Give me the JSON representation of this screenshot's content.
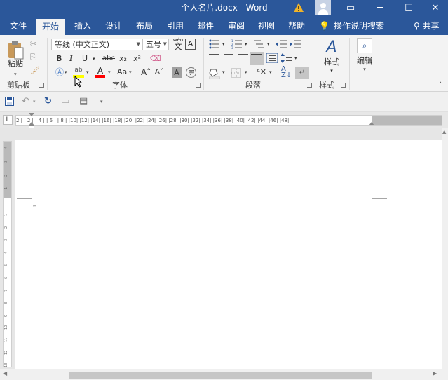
{
  "titlebar": {
    "title": "个人名片.docx  -  Word",
    "minimize": "─",
    "restore": "☐",
    "close": "✕",
    "ribbon_display": "▭"
  },
  "tabs": [
    "文件",
    "开始",
    "插入",
    "设计",
    "布局",
    "引用",
    "邮件",
    "审阅",
    "视图",
    "帮助"
  ],
  "active_tab": "开始",
  "tell_me": "操作说明搜索",
  "share": "共享",
  "ribbon": {
    "clipboard": {
      "paste_label": "粘贴",
      "group_label": "剪贴板"
    },
    "font": {
      "font_name": "等线 (中文正文)",
      "font_size": "五号",
      "wen": "wén",
      "wen_char": "文",
      "a_box": "A",
      "bold": "B",
      "italic": "I",
      "underline": "U",
      "strike": "abc",
      "subscript": "x₂",
      "superscript": "x²",
      "change_case": "Aa",
      "grow": "A˄",
      "shrink": "A˅",
      "char_shading": "A",
      "enclose": "字",
      "group_label": "字体"
    },
    "paragraph": {
      "group_label": "段落"
    },
    "styles": {
      "label": "样式",
      "group_label": "样式"
    },
    "editing": {
      "label": "编辑"
    }
  },
  "ruler": {
    "tab_selector": "L",
    "numbers": "2 |  | 2 |  | 4 |  | 6 |  | 8 |  |10|  |12|  |14|  |16|  |18|  |20|  |22|  |24|  |26|  |28|  |30|  |32|  |34|  |36|  |38|  |40|  |42|  |44|  |46|  |48|"
  },
  "document": {
    "paragraph_mark": "↵"
  },
  "colors": {
    "accent": "#2b579a",
    "ribbon_bg": "#f3f3f3",
    "highlight_yellow": "#ffff00",
    "font_red": "#ff0000",
    "warning": "#f0b429"
  }
}
